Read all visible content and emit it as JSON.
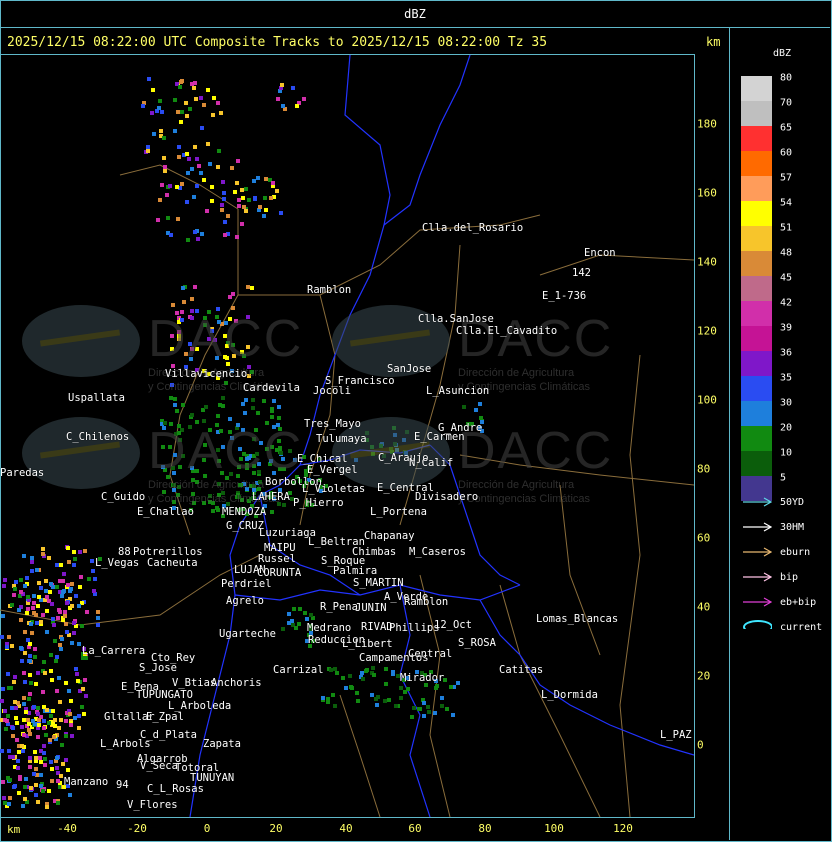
{
  "window_title": "dBZ",
  "header": {
    "title": "2025/12/15 08:22:00 UTC Composite Tracks to 2025/12/15 08:22:00 Tz 35",
    "km_label": "km"
  },
  "axes": {
    "x_km_label": "km",
    "x_ticks": [
      "-40",
      "-20",
      "0",
      "20",
      "40",
      "60",
      "80",
      "100",
      "120"
    ],
    "y_ticks": [
      "180",
      "160",
      "140",
      "120",
      "100",
      "80",
      "60",
      "40",
      "20",
      "0"
    ]
  },
  "legend": {
    "title": "dBZ",
    "levels": [
      {
        "label": "80",
        "color": "#d3d3d3"
      },
      {
        "label": "70",
        "color": "#bfbfbf"
      },
      {
        "label": "65",
        "color": "#ff3030"
      },
      {
        "label": "60",
        "color": "#ff6a00"
      },
      {
        "label": "57",
        "color": "#ff9c5a"
      },
      {
        "label": "54",
        "color": "#ffff00"
      },
      {
        "label": "51",
        "color": "#f7c52b"
      },
      {
        "label": "48",
        "color": "#d98a37"
      },
      {
        "label": "45",
        "color": "#bf6a8a"
      },
      {
        "label": "42",
        "color": "#d12faa"
      },
      {
        "label": "39",
        "color": "#c51395"
      },
      {
        "label": "36",
        "color": "#7f17c9"
      },
      {
        "label": "35",
        "color": "#2a4cf2"
      },
      {
        "label": "30",
        "color": "#1e7fdc"
      },
      {
        "label": "20",
        "color": "#118a11"
      },
      {
        "label": "10",
        "color": "#0b5d0b"
      },
      {
        "label": "5",
        "color": "#43378f"
      }
    ],
    "tracks": [
      {
        "label": "50YD",
        "color": "#5fd7e6"
      },
      {
        "label": "30HM",
        "color": "#ffffff"
      },
      {
        "label": "eburn",
        "color": "#e8b870"
      },
      {
        "label": "bip",
        "color": "#ffc4e6"
      },
      {
        "label": "eb+bip",
        "color": "#e03fd6"
      },
      {
        "label": "current",
        "color": "#3fe6ff"
      }
    ]
  },
  "watermark": {
    "brand": "DACC",
    "line1": "Dirección de Agricultura",
    "line2": "y Contingencias Climáticas"
  },
  "places": [
    {
      "name": "Clla.del_Rosario"
    },
    {
      "name": "Encon"
    },
    {
      "name": "142"
    },
    {
      "name": "E_1-736"
    },
    {
      "name": "Ramblon"
    },
    {
      "name": "Clla.SanJose"
    },
    {
      "name": "Clla.El_Cavadito"
    },
    {
      "name": "Villavicencio"
    },
    {
      "name": "Uspallata"
    },
    {
      "name": "Cardevila"
    },
    {
      "name": "S_Francisco"
    },
    {
      "name": "Jocoli"
    },
    {
      "name": "SanJose"
    },
    {
      "name": "L_Asuncion"
    },
    {
      "name": "Tres_Mayo"
    },
    {
      "name": "Tulumaya"
    },
    {
      "name": "G_Andre"
    },
    {
      "name": "E_Carmen"
    },
    {
      "name": "C_Chilenos"
    },
    {
      "name": "E_Chical"
    },
    {
      "name": "E_Vergel"
    },
    {
      "name": "C_Araujo"
    },
    {
      "name": "N_Calif"
    },
    {
      "name": "Paredas"
    },
    {
      "name": "Borbollon"
    },
    {
      "name": "L_Violetas"
    },
    {
      "name": "E_Central"
    },
    {
      "name": "Divisadero"
    },
    {
      "name": "C_Guido"
    },
    {
      "name": "LAHERA"
    },
    {
      "name": "P_Hierro"
    },
    {
      "name": "E_Challao"
    },
    {
      "name": "MENDOZA"
    },
    {
      "name": "L_Portena"
    },
    {
      "name": "G_CRUZ"
    },
    {
      "name": "Luzuriaga"
    },
    {
      "name": "Chapanay"
    },
    {
      "name": "88"
    },
    {
      "name": "Potrerillos"
    },
    {
      "name": "L_Beltran"
    },
    {
      "name": "MAIPU"
    },
    {
      "name": "Chimbas"
    },
    {
      "name": "M_Caseros"
    },
    {
      "name": "L_Vegas"
    },
    {
      "name": "Cacheuta"
    },
    {
      "name": "Russel"
    },
    {
      "name": "S_Roque"
    },
    {
      "name": "LUJAN"
    },
    {
      "name": "CORUNTA"
    },
    {
      "name": "Palmira"
    },
    {
      "name": "Perdriel"
    },
    {
      "name": "S_MARTIN"
    },
    {
      "name": "A_Verde"
    },
    {
      "name": "Agrelo"
    },
    {
      "name": "R_Pena"
    },
    {
      "name": "JUNIN"
    },
    {
      "name": "Ramblon"
    },
    {
      "name": "Lomas_Blancas"
    },
    {
      "name": "Ugarteche"
    },
    {
      "name": "Medrano"
    },
    {
      "name": "RIVAD"
    },
    {
      "name": "Phillips"
    },
    {
      "name": "12_Oct"
    },
    {
      "name": "Reduccion"
    },
    {
      "name": "L_Libert"
    },
    {
      "name": "S_ROSA"
    },
    {
      "name": "La_Carrera"
    },
    {
      "name": "Cto_Rey"
    },
    {
      "name": "Campamentos"
    },
    {
      "name": "Central"
    },
    {
      "name": "S_Jose"
    },
    {
      "name": "Carrizal"
    },
    {
      "name": "Catitas"
    },
    {
      "name": "E_Pena"
    },
    {
      "name": "V_Btias"
    },
    {
      "name": "Anchoris"
    },
    {
      "name": "Mirador"
    },
    {
      "name": "TUPUNGATO"
    },
    {
      "name": "L_Dormida"
    },
    {
      "name": "L_Arboleda"
    },
    {
      "name": "Gltallar"
    },
    {
      "name": "E_Zpal"
    },
    {
      "name": "C_d_Plata"
    },
    {
      "name": "L_Arbols"
    },
    {
      "name": "Zapata"
    },
    {
      "name": "L_PAZ"
    },
    {
      "name": "Algarrob"
    },
    {
      "name": "V_Seca"
    },
    {
      "name": "Totoral"
    },
    {
      "name": "TUNUYAN"
    },
    {
      "name": "Manzano"
    },
    {
      "name": "94"
    },
    {
      "name": "C_L_Rosas"
    },
    {
      "name": "V_Flores"
    }
  ]
}
